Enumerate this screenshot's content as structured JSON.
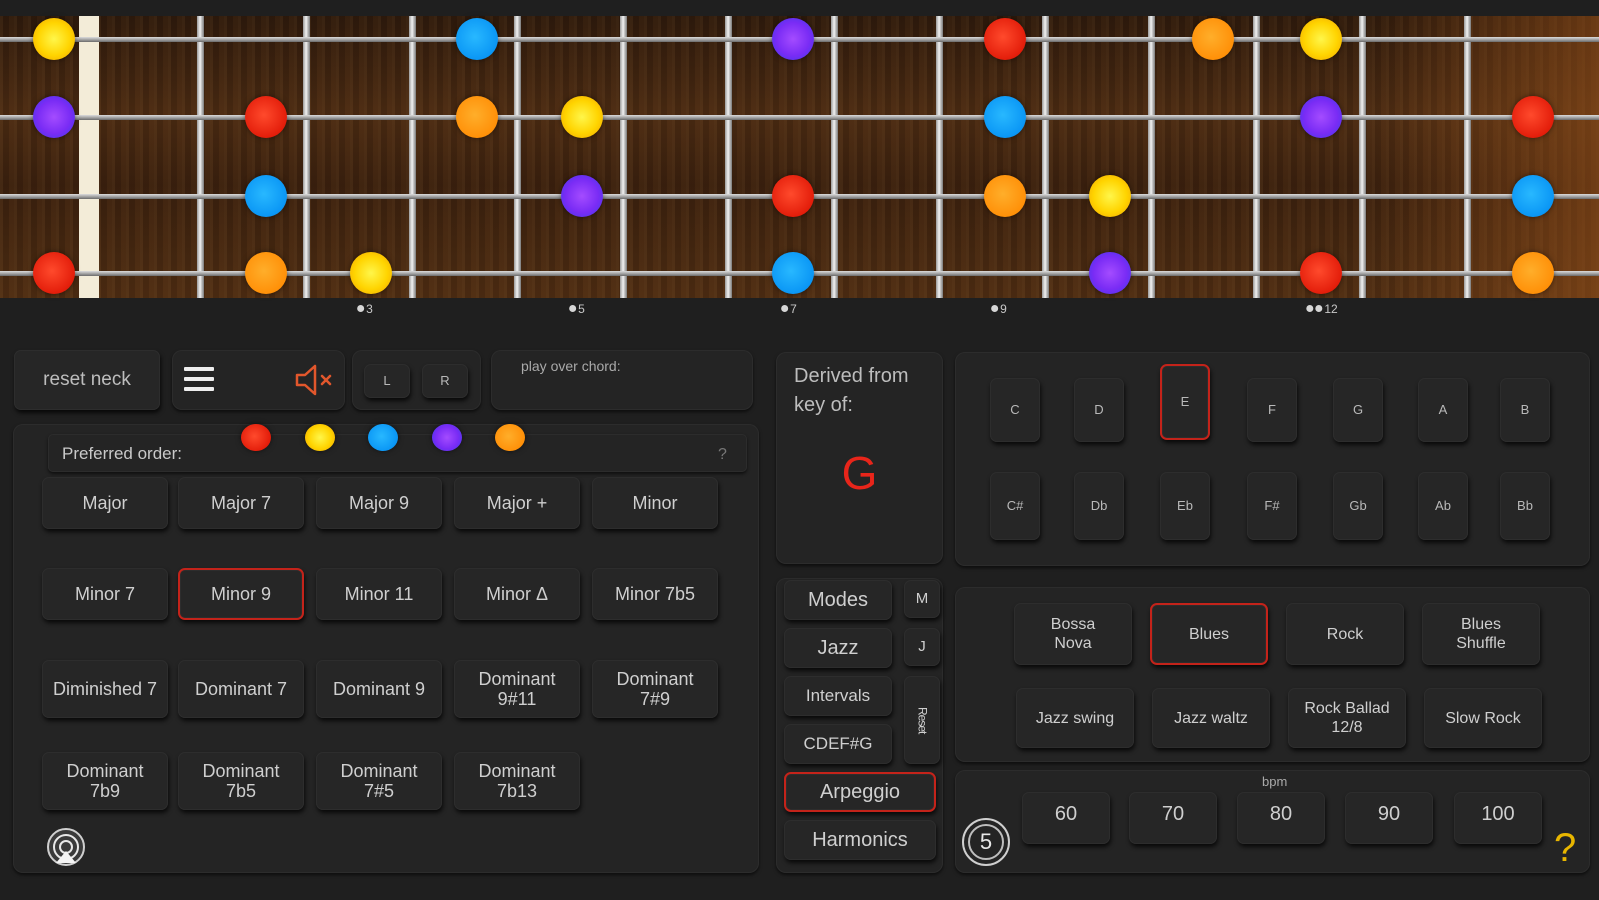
{
  "neck": {
    "fret_markers": [
      {
        "dots": "1",
        "label": "3"
      },
      {
        "dots": "1",
        "label": "5"
      },
      {
        "dots": "1",
        "label": "7"
      },
      {
        "dots": "1",
        "label": "9"
      },
      {
        "dots": "2",
        "label": "12"
      }
    ],
    "notes": [
      {
        "string": 1,
        "fret": 0,
        "color": "yellow"
      },
      {
        "string": 1,
        "fret": 4,
        "color": "blue"
      },
      {
        "string": 1,
        "fret": 7,
        "color": "purple"
      },
      {
        "string": 1,
        "fret": 9,
        "color": "red"
      },
      {
        "string": 1,
        "fret": 11,
        "color": "orange"
      },
      {
        "string": 1,
        "fret": 12,
        "color": "yellow"
      },
      {
        "string": 2,
        "fret": 0,
        "color": "purple"
      },
      {
        "string": 2,
        "fret": 2,
        "color": "red"
      },
      {
        "string": 2,
        "fret": 4,
        "color": "orange"
      },
      {
        "string": 2,
        "fret": 5,
        "color": "yellow"
      },
      {
        "string": 2,
        "fret": 9,
        "color": "blue"
      },
      {
        "string": 2,
        "fret": 12,
        "color": "purple"
      },
      {
        "string": 2,
        "fret": 14,
        "color": "red"
      },
      {
        "string": 3,
        "fret": 2,
        "color": "blue"
      },
      {
        "string": 3,
        "fret": 5,
        "color": "purple"
      },
      {
        "string": 3,
        "fret": 7,
        "color": "red"
      },
      {
        "string": 3,
        "fret": 9,
        "color": "orange"
      },
      {
        "string": 3,
        "fret": 10,
        "color": "yellow"
      },
      {
        "string": 3,
        "fret": 14,
        "color": "blue"
      },
      {
        "string": 4,
        "fret": 0,
        "color": "red"
      },
      {
        "string": 4,
        "fret": 2,
        "color": "orange"
      },
      {
        "string": 4,
        "fret": 3,
        "color": "yellow"
      },
      {
        "string": 4,
        "fret": 7,
        "color": "blue"
      },
      {
        "string": 4,
        "fret": 10,
        "color": "purple"
      },
      {
        "string": 4,
        "fret": 12,
        "color": "red"
      },
      {
        "string": 4,
        "fret": 14,
        "color": "orange"
      }
    ]
  },
  "toolbar": {
    "reset_neck": "reset neck",
    "menu_icon": "hamburger-menu-icon",
    "mute_icon": "speaker-muted-icon",
    "left_hand": "L",
    "right_hand": "R",
    "play_over_chord": "play over chord:"
  },
  "chord_panel": {
    "preferred_order_label": "Preferred order:",
    "preferred_order_colors": [
      "red",
      "yellow",
      "blue",
      "purple",
      "orange"
    ],
    "help": "?",
    "chords": [
      [
        "Major",
        "Major 7",
        "Major 9",
        "Major +",
        "Minor"
      ],
      [
        "Minor 7",
        "Minor 9",
        "Minor 11",
        "Minor Δ",
        "Minor 7b5"
      ],
      [
        "Diminished 7",
        "Dominant 7",
        "Dominant 9",
        "Dominant 9#11",
        "Dominant 7#9"
      ],
      [
        "Dominant 7b9",
        "Dominant 7b5",
        "Dominant 7#5",
        "Dominant 7b13"
      ]
    ],
    "selected": "Minor 9",
    "bottom_icon": "airplay-icon"
  },
  "key_panel": {
    "derived_label_line1": "Derived from",
    "derived_label_line2": "key of:",
    "key": "G",
    "key_color": "#e8251a",
    "natural_keys": [
      "C",
      "D",
      "E",
      "F",
      "G",
      "A",
      "B"
    ],
    "accidental_keys": [
      "C#",
      "Db",
      "Eb",
      "F#",
      "Gb",
      "Ab",
      "Bb"
    ],
    "selected_key": "E"
  },
  "mode_panel": {
    "modes": [
      "Modes",
      "Jazz",
      "Intervals",
      "CDEF#G",
      "Arpeggio",
      "Harmonics"
    ],
    "side_m": "M",
    "side_j": "J",
    "side_reset": "Reset",
    "selected": "Arpeggio"
  },
  "rhythm_panel": {
    "styles_row1": [
      "Bossa Nova",
      "Blues",
      "Rock",
      "Blues Shuffle"
    ],
    "styles_row2": [
      "Jazz swing",
      "Jazz waltz",
      "Rock Ballad 12/8",
      "Slow Rock"
    ],
    "selected": "Blues"
  },
  "tempo_panel": {
    "bpm_label": "bpm",
    "count": "5",
    "tempos": [
      "60",
      "70",
      "80",
      "90",
      "100"
    ],
    "help": "?"
  },
  "colors": {
    "red": "#e31d0a",
    "yellow": "#ffd400",
    "blue": "#0a96f5",
    "purple": "#7a2cf5",
    "orange": "#ff9008",
    "accent": "#c4231a"
  }
}
